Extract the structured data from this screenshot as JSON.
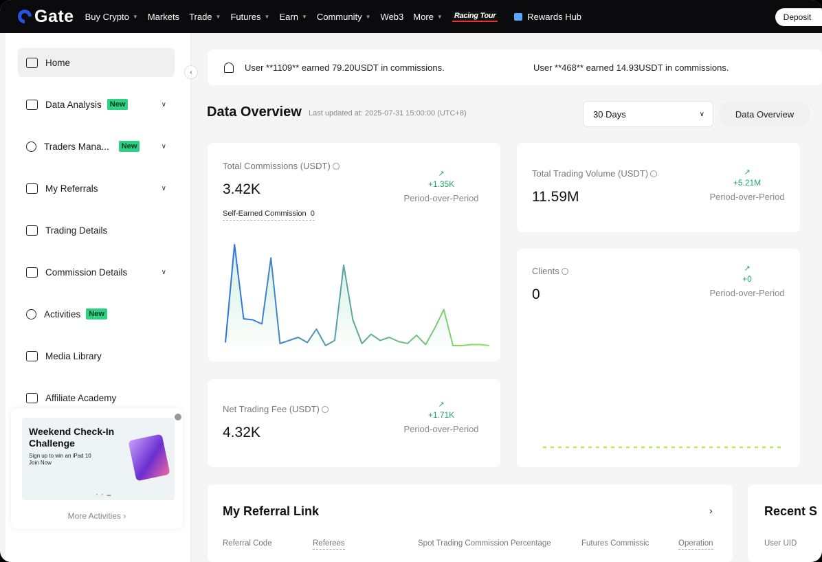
{
  "nav": {
    "logo": "Gate",
    "items": [
      {
        "label": "Buy Crypto",
        "caret": true
      },
      {
        "label": "Markets",
        "caret": false
      },
      {
        "label": "Trade",
        "caret": true
      },
      {
        "label": "Futures",
        "caret": true
      },
      {
        "label": "Earn",
        "caret": true
      },
      {
        "label": "Community",
        "caret": true
      },
      {
        "label": "Web3",
        "caret": false
      },
      {
        "label": "More",
        "caret": true
      }
    ],
    "racing": "Racing Tour",
    "rewards": "Rewards Hub",
    "deposit": "Deposit"
  },
  "sidebar": {
    "items": [
      {
        "label": "Home",
        "badge": "",
        "chevron": false,
        "icon": "home-dashboard-icon"
      },
      {
        "label": "Data Analysis",
        "badge": "New",
        "chevron": true,
        "icon": "data-analysis-icon"
      },
      {
        "label": "Traders Mana...",
        "badge": "New",
        "chevron": true,
        "icon": "traders-icon"
      },
      {
        "label": "My Referrals",
        "badge": "",
        "chevron": true,
        "icon": "paper-plane-icon"
      },
      {
        "label": "Trading Details",
        "badge": "",
        "chevron": false,
        "icon": "trading-details-icon"
      },
      {
        "label": "Commission Details",
        "badge": "",
        "chevron": true,
        "icon": "percent-icon"
      },
      {
        "label": "Activities",
        "badge": "New",
        "chevron": false,
        "icon": "trophy-icon"
      },
      {
        "label": "Media Library",
        "badge": "",
        "chevron": false,
        "icon": "folder-icon"
      },
      {
        "label": "Affiliate Academy",
        "badge": "",
        "chevron": false,
        "icon": "book-icon"
      }
    ],
    "promo": {
      "title": "Weekend Check-In Challenge",
      "subtitle_line1": "Sign up to win an iPad 10",
      "subtitle_line2": "Join Now",
      "more": "More Activities ›"
    }
  },
  "ticker": {
    "msg1": "User **1109** earned 79.20USDT in commissions.",
    "msg2": "User **468** earned 14.93USDT in commissions."
  },
  "overview": {
    "title": "Data Overview",
    "updated": "Last updated at: 2025-07-31 15:00:00 (UTC+8)",
    "range": "30 Days",
    "button": "Data Overview"
  },
  "cards": {
    "commissions": {
      "label": "Total Commissions (USDT)",
      "value": "3.42K",
      "delta": "+1.35K",
      "pp": "Period-over-Period",
      "self_label": "Self-Earned Commission",
      "self_value": "0"
    },
    "volume": {
      "label": "Total Trading Volume (USDT)",
      "value": "11.59M",
      "delta": "+5.21M",
      "pp": "Period-over-Period"
    },
    "clients": {
      "label": "Clients",
      "value": "0",
      "delta": "+0",
      "pp": "Period-over-Period"
    },
    "fee": {
      "label": "Net Trading Fee (USDT)",
      "value": "4.32K",
      "delta": "+1.71K",
      "pp": "Period-over-Period"
    }
  },
  "chart_data": {
    "type": "area",
    "x": [
      1,
      2,
      3,
      4,
      5,
      6,
      7,
      8,
      9,
      10,
      11,
      12,
      13,
      14,
      15,
      16,
      17,
      18,
      19,
      20,
      21,
      22,
      23,
      24,
      25,
      26,
      27,
      28,
      29,
      30
    ],
    "series": [
      {
        "values": [
          0.05,
          1.0,
          0.28,
          0.27,
          0.23,
          0.87,
          0.04,
          0.07,
          0.1,
          0.05,
          0.18,
          0.02,
          0.07,
          0.8,
          0.27,
          0.04,
          0.13,
          0.07,
          0.1,
          0.06,
          0.04,
          0.12,
          0.03,
          0.19,
          0.37,
          0.02,
          0.02,
          0.03,
          0.03,
          0.02
        ]
      }
    ],
    "grid": false,
    "legend": "none"
  },
  "referral": {
    "title": "My Referral Link",
    "columns": [
      "Referral Code",
      "Referees",
      "Spot Trading Commission Percentage",
      "Futures Commissic",
      "Operation"
    ]
  },
  "recent": {
    "title": "Recent S",
    "column": "User UID"
  },
  "colors": {
    "accent": "#2354e6",
    "positive": "#1fa765",
    "badge": "#2cd283",
    "chart_start": "#2f6fe0",
    "chart_end": "#8ee05a"
  }
}
